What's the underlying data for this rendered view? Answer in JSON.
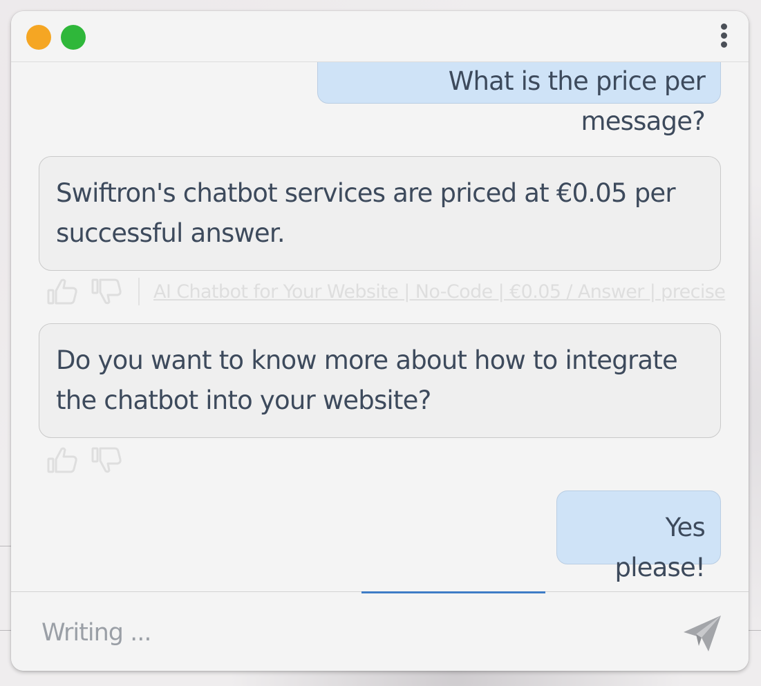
{
  "header": {
    "colors": {
      "dot_orange": "#f5a623",
      "dot_green": "#2fb73a"
    },
    "menu_icon": "kebab-menu-icon"
  },
  "messages": [
    {
      "role": "user",
      "text": "What is the price per message?"
    },
    {
      "role": "bot",
      "text": "Swiftron's chatbot services are priced at €0.05 per successful answer.",
      "source_link": "AI Chatbot for Your Website | No-Code | €0.05 / Answer | precise"
    },
    {
      "role": "bot",
      "text": "Do you want to know more about how to integrate the chatbot into your website?"
    },
    {
      "role": "user",
      "text": "Yes please!"
    }
  ],
  "feedback_icons": {
    "like": "thumbs-up-icon",
    "dislike": "thumbs-down-icon"
  },
  "composer": {
    "placeholder": "Writing ...",
    "value": "",
    "send_icon": "paper-plane-icon",
    "accent_color": "#3e7cc6"
  }
}
